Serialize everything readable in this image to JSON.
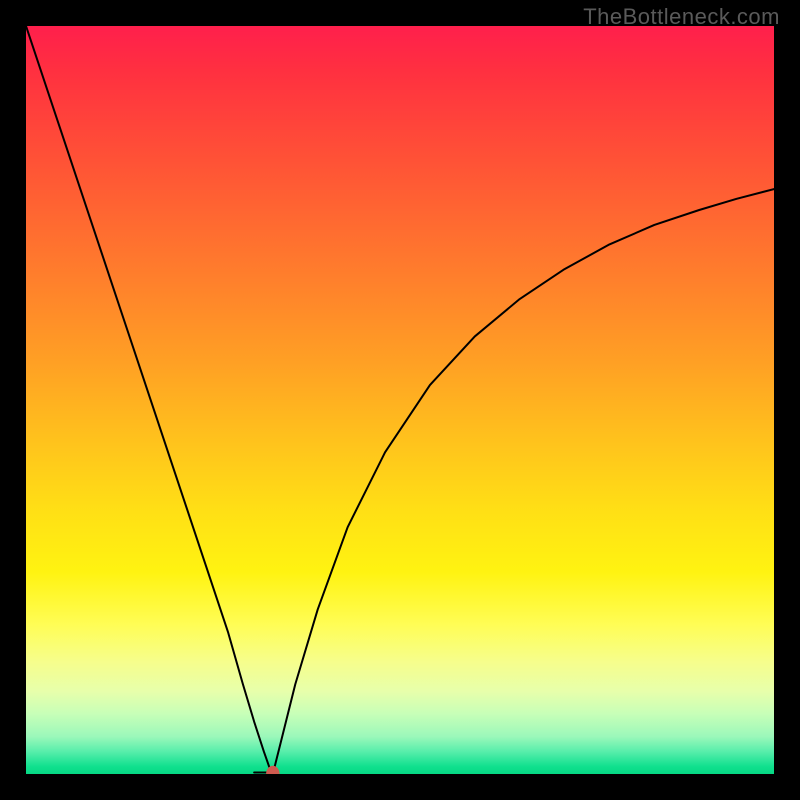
{
  "watermark": "TheBottleneck.com",
  "chart_data": {
    "type": "line",
    "title": "",
    "xlabel": "",
    "ylabel": "",
    "xlim": [
      0,
      100
    ],
    "ylim": [
      0,
      100
    ],
    "grid": false,
    "legend": false,
    "background_gradient": {
      "direction": "vertical",
      "stops": [
        {
          "pos": 0,
          "color": "#ff1f4c"
        },
        {
          "pos": 18,
          "color": "#ff5236"
        },
        {
          "pos": 45,
          "color": "#ffa024"
        },
        {
          "pos": 73,
          "color": "#fff311"
        },
        {
          "pos": 92,
          "color": "#c7ffb8"
        },
        {
          "pos": 100,
          "color": "#06d884"
        }
      ]
    },
    "minimum_marker": {
      "x": 33,
      "y": 0,
      "color": "#cf5b4f"
    },
    "series": [
      {
        "name": "left-branch",
        "x": [
          0,
          4,
          8,
          12,
          16,
          20,
          24,
          27,
          29,
          30.5,
          31.8,
          32.5,
          33
        ],
        "y": [
          100,
          88,
          76,
          64,
          52,
          40,
          28,
          19,
          12,
          7,
          3,
          1,
          0
        ]
      },
      {
        "name": "flat-valley",
        "x": [
          30.5,
          33.5
        ],
        "y": [
          0.2,
          0.2
        ]
      },
      {
        "name": "right-branch",
        "x": [
          33,
          34,
          36,
          39,
          43,
          48,
          54,
          60,
          66,
          72,
          78,
          84,
          90,
          95,
          100
        ],
        "y": [
          0,
          4,
          12,
          22,
          33,
          43,
          52,
          58.5,
          63.5,
          67.5,
          70.8,
          73.4,
          75.4,
          76.9,
          78.2
        ]
      }
    ]
  }
}
